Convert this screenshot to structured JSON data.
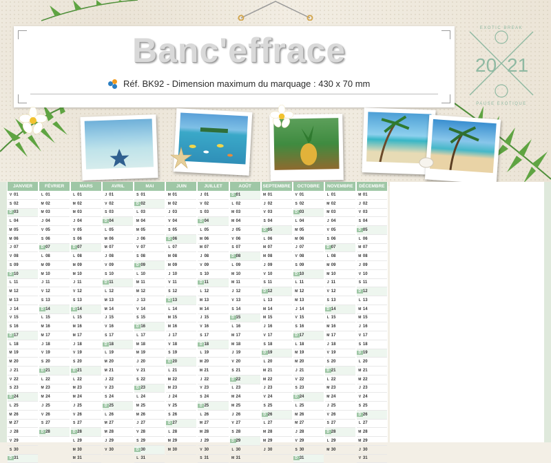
{
  "header": {
    "brand": "Banc'effrace",
    "reference": "Réf. BK92 - Dimension maximum du marquage : 430 x 70 mm"
  },
  "badge": {
    "top_text": "EXOTIC BREAK",
    "bottom_text": "PAUSE EXOTIQUE",
    "year_left": "20",
    "year_right": "21"
  },
  "calendar": {
    "months": [
      "JANVIER",
      "FÉVRIER",
      "MARS",
      "AVRIL",
      "MAI",
      "JUIN",
      "JUILLET",
      "AOÛT",
      "SEPTEMBRE",
      "OCTOBRE",
      "NOVEMBRE",
      "DÉCEMBRE"
    ],
    "first_weekday": [
      4,
      0,
      0,
      3,
      5,
      1,
      3,
      6,
      2,
      4,
      0,
      2
    ],
    "days_in_month": [
      31,
      28,
      31,
      30,
      31,
      30,
      31,
      31,
      30,
      31,
      30,
      31
    ],
    "weekday_letters": [
      "L",
      "M",
      "M",
      "J",
      "V",
      "S",
      "D"
    ]
  },
  "colors": {
    "accent": "#9fc7a6",
    "sand": "#efe9dd"
  }
}
